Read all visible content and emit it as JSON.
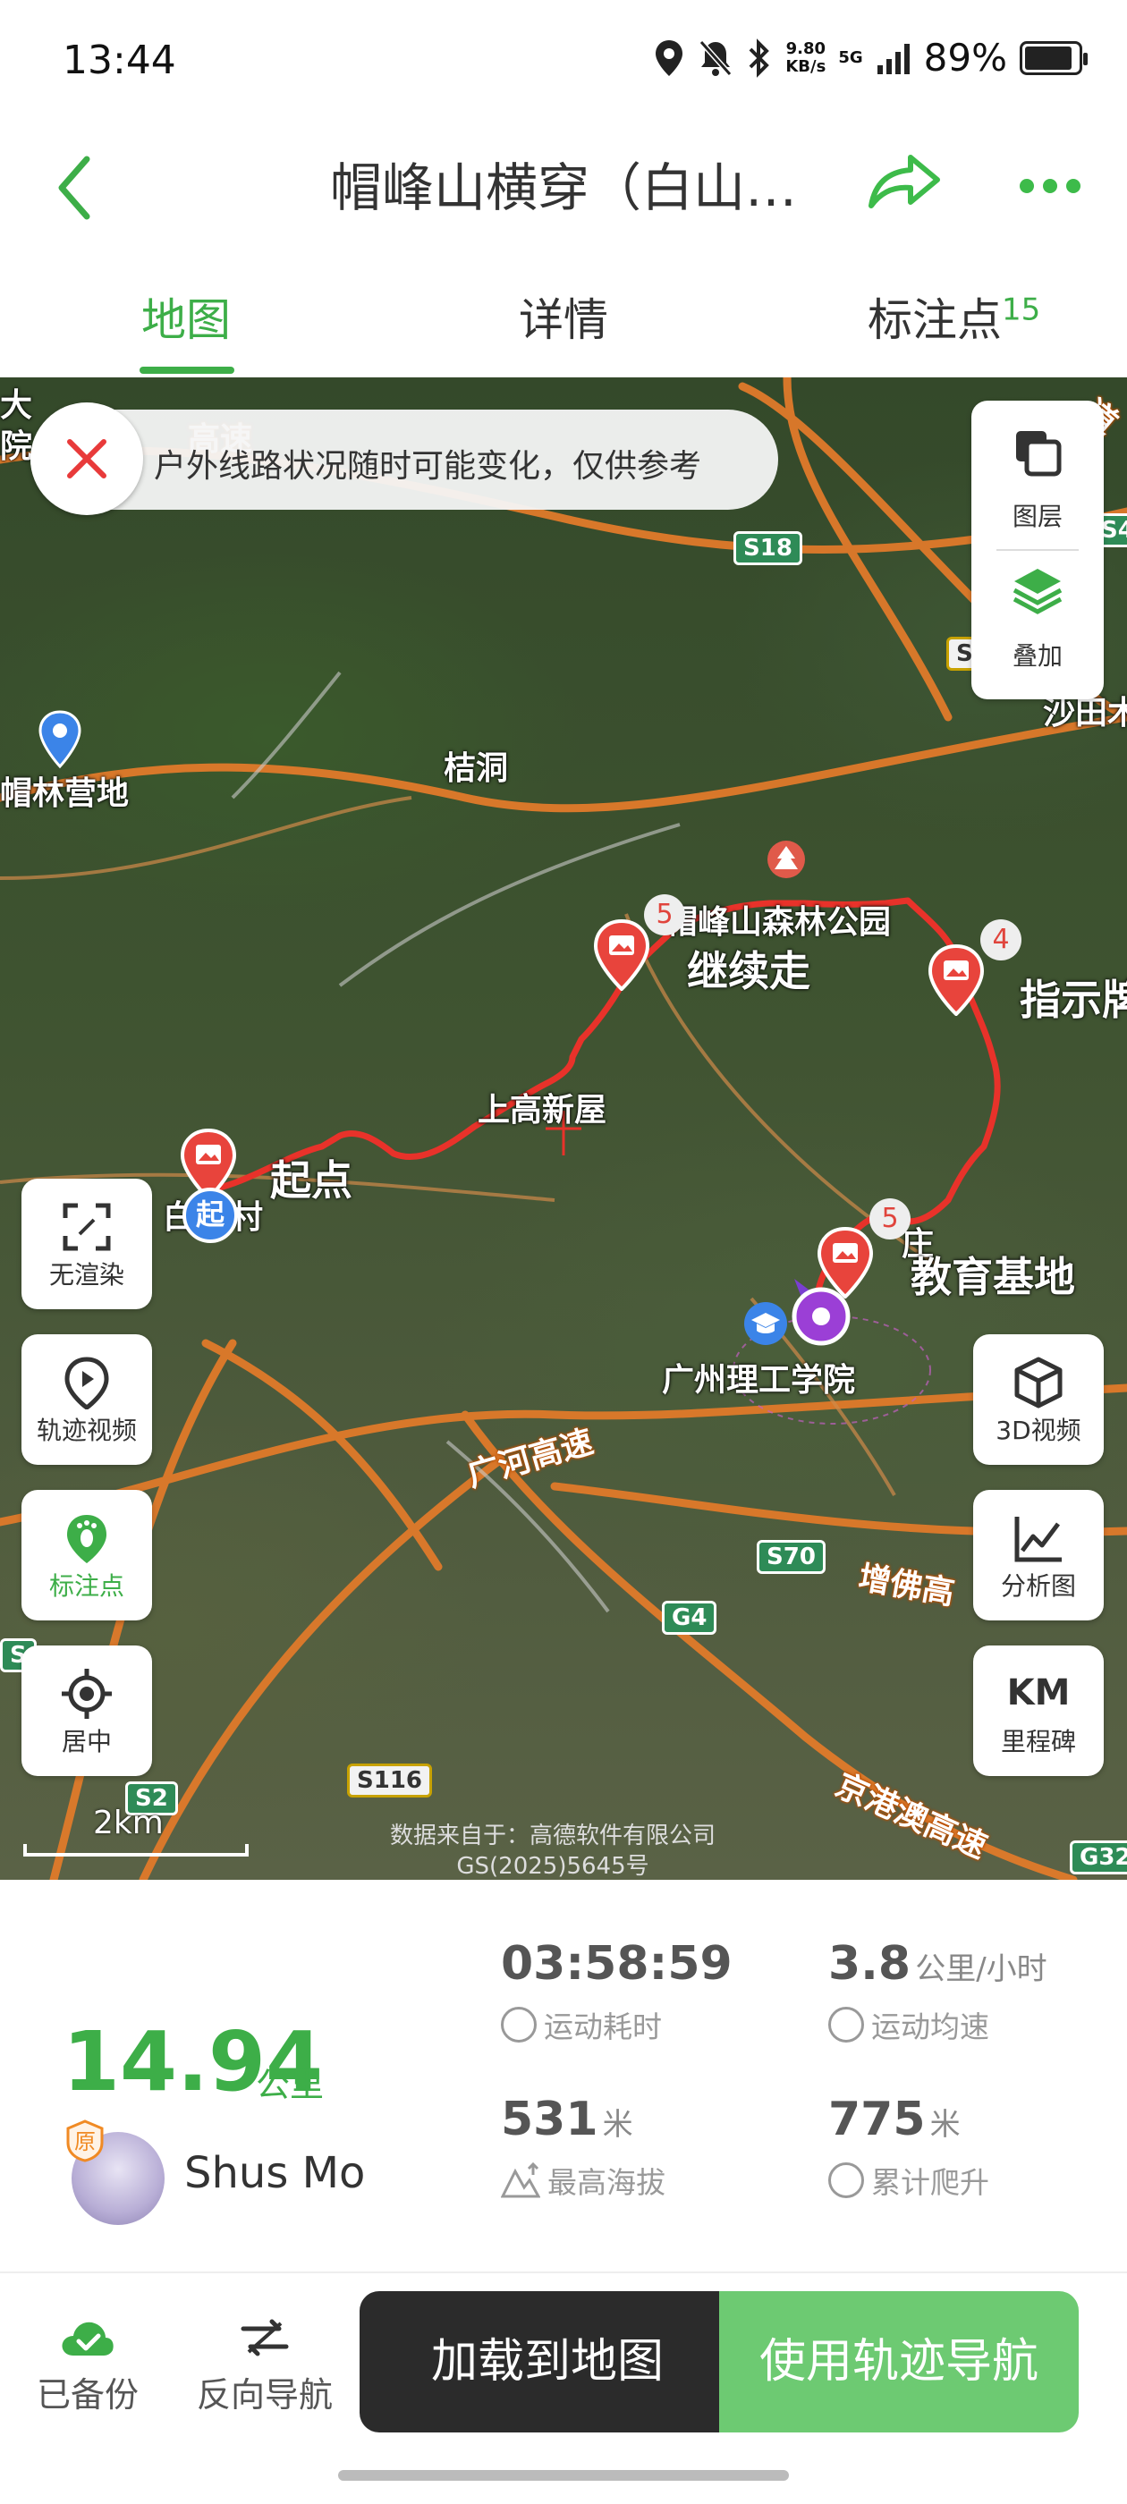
{
  "status_bar": {
    "time": "13:44",
    "net_speed_value": "9.80",
    "net_speed_unit": "KB/s",
    "signal": "5G",
    "battery": "89%"
  },
  "header": {
    "title": "帽峰山横穿（白山…",
    "accent_color": "#3dae48"
  },
  "tabs": [
    {
      "label": "地图",
      "active": true
    },
    {
      "label": "详情",
      "active": false
    },
    {
      "label": "标注点",
      "badge": "15",
      "active": false
    }
  ],
  "map": {
    "notice": "户外线路状况随时可能变化，仅供参考",
    "layer_panel": {
      "layers_label": "图层",
      "overlay_label": "叠加"
    },
    "left_buttons": [
      "无渲染",
      "轨迹视频",
      "标注点",
      "居中"
    ],
    "right_buttons": [
      "3D视频",
      "分析图",
      "里程碑"
    ],
    "milestone_icon_text": "KM",
    "place_labels": {
      "da": "大",
      "yuan": "院",
      "maolin": "帽林营地",
      "jiedong": "桔洞",
      "forest_park": "帽峰山森林公园",
      "shangaoxinwu": "上高新屋",
      "baishan": "白",
      "cun": "村",
      "zhuang": "庄",
      "college": "广州理工学院",
      "shatian": "沙田木"
    },
    "waypoint_labels": {
      "start": "起点",
      "continue": "继续走",
      "sign": "指示牌",
      "base": "教育基地"
    },
    "start_marker": "起",
    "waypoint_counts": [
      "5",
      "4",
      "5"
    ],
    "road_labels": {
      "gaosu_top": "高速",
      "guanghe": "广河高速",
      "zengfo": "增佛高",
      "jinggangao": "京港澳高速",
      "dao": "道"
    },
    "shields": [
      "S18",
      "S2",
      "S4",
      "S70",
      "G4",
      "S116",
      "S2",
      "S",
      "G32"
    ],
    "scale": "2km",
    "credit_line1": "数据来自于：高德软件有限公司",
    "credit_line2": "GS(2025)5645号",
    "track_color": "#e8322a"
  },
  "stats": {
    "distance": "14.94",
    "distance_unit": "公里",
    "user_name": "Shus Mo",
    "original_badge": "原",
    "moving_time": "03:58:59",
    "moving_time_label": "运动耗时",
    "avg_speed": "3.8",
    "avg_speed_unit": "公里/小时",
    "avg_speed_label": "运动均速",
    "max_altitude": "531",
    "max_altitude_unit": "米",
    "max_altitude_label": "最高海拔",
    "total_climb": "775",
    "total_climb_unit": "米",
    "total_climb_label": "累计爬升"
  },
  "bottom_bar": {
    "backup_label": "已备份",
    "reverse_label": "反向导航",
    "load_label": "加载到地图",
    "navigate_label": "使用轨迹导航"
  }
}
